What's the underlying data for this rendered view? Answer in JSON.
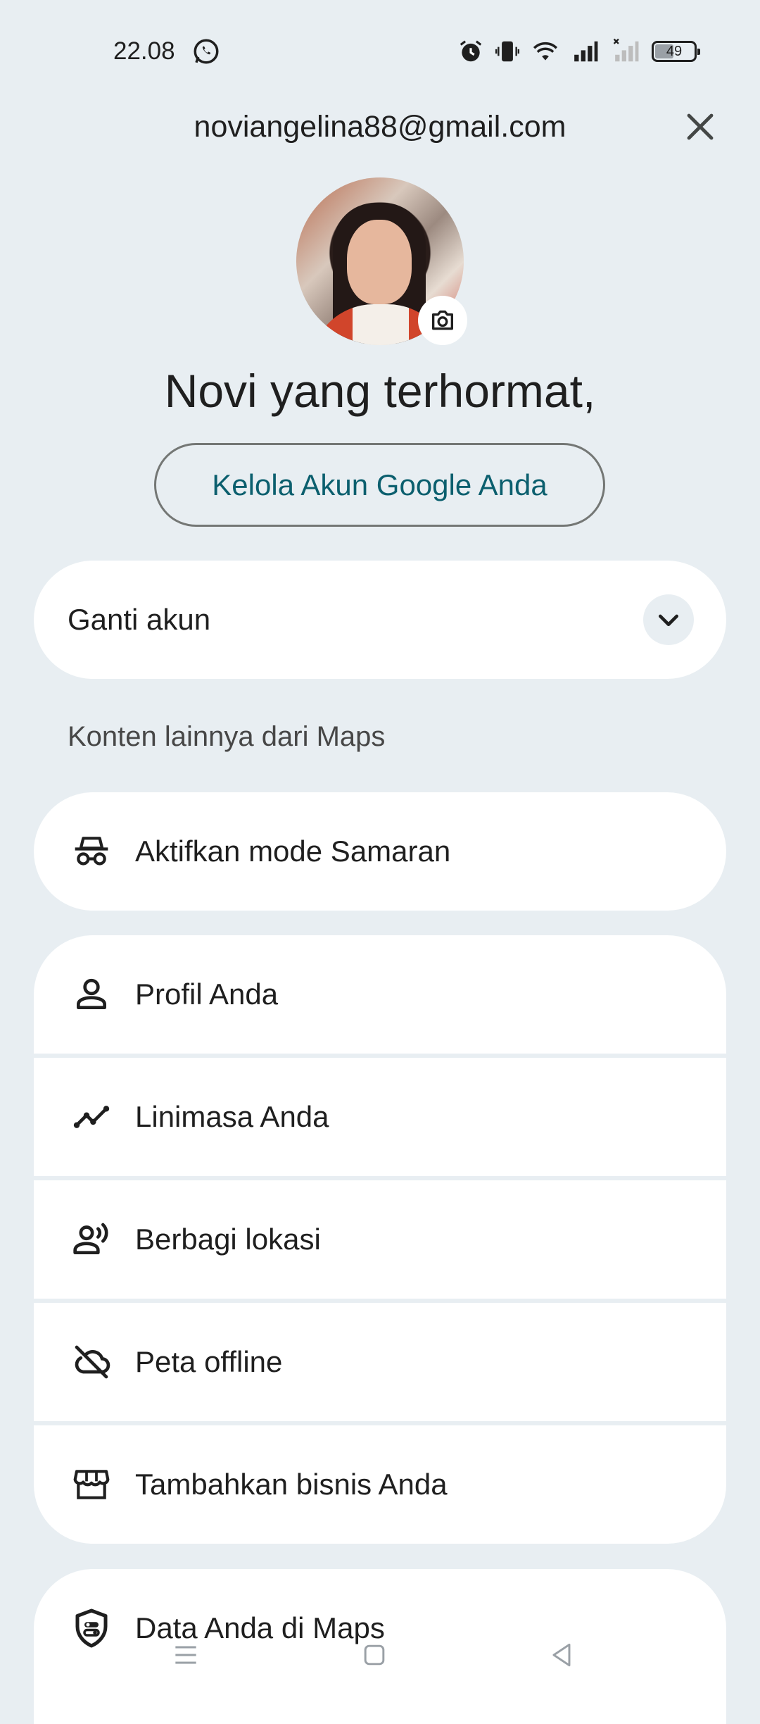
{
  "status_bar": {
    "time": "22.08",
    "battery_level": "49",
    "icons": [
      "whatsapp-icon",
      "alarm-icon",
      "vibrate-icon",
      "wifi-icon",
      "signal-icon",
      "signal-no-service-icon",
      "battery-icon"
    ]
  },
  "header": {
    "email": "noviangelina88@gmail.com",
    "close_icon": "close-icon"
  },
  "profile": {
    "greeting": "Novi yang terhormat,",
    "manage_account_label": "Kelola Akun Google Anda",
    "camera_icon": "camera-icon"
  },
  "switch_account": {
    "label": "Ganti akun",
    "icon": "chevron-down-icon"
  },
  "section": {
    "label": "Konten lainnya dari Maps"
  },
  "incognito": {
    "label": "Aktifkan mode Samaran",
    "icon": "incognito-icon"
  },
  "menu": {
    "items": [
      {
        "label": "Profil Anda",
        "icon": "person-icon"
      },
      {
        "label": "Linimasa Anda",
        "icon": "timeline-icon"
      },
      {
        "label": "Berbagi lokasi",
        "icon": "location-sharing-icon"
      },
      {
        "label": "Peta offline",
        "icon": "cloud-off-icon"
      },
      {
        "label": "Tambahkan bisnis Anda",
        "icon": "storefront-icon"
      }
    ]
  },
  "data_in_maps": {
    "label": "Data Anda di Maps",
    "icon": "shield-icon"
  },
  "nav_bar": {
    "items": [
      "menu-nav-icon",
      "home-nav-icon",
      "back-nav-icon"
    ]
  },
  "colors": {
    "background": "#e8eef2",
    "card": "#ffffff",
    "accent_text": "#0b5f6e",
    "text_primary": "#1f1f1f",
    "text_secondary": "#474747"
  }
}
